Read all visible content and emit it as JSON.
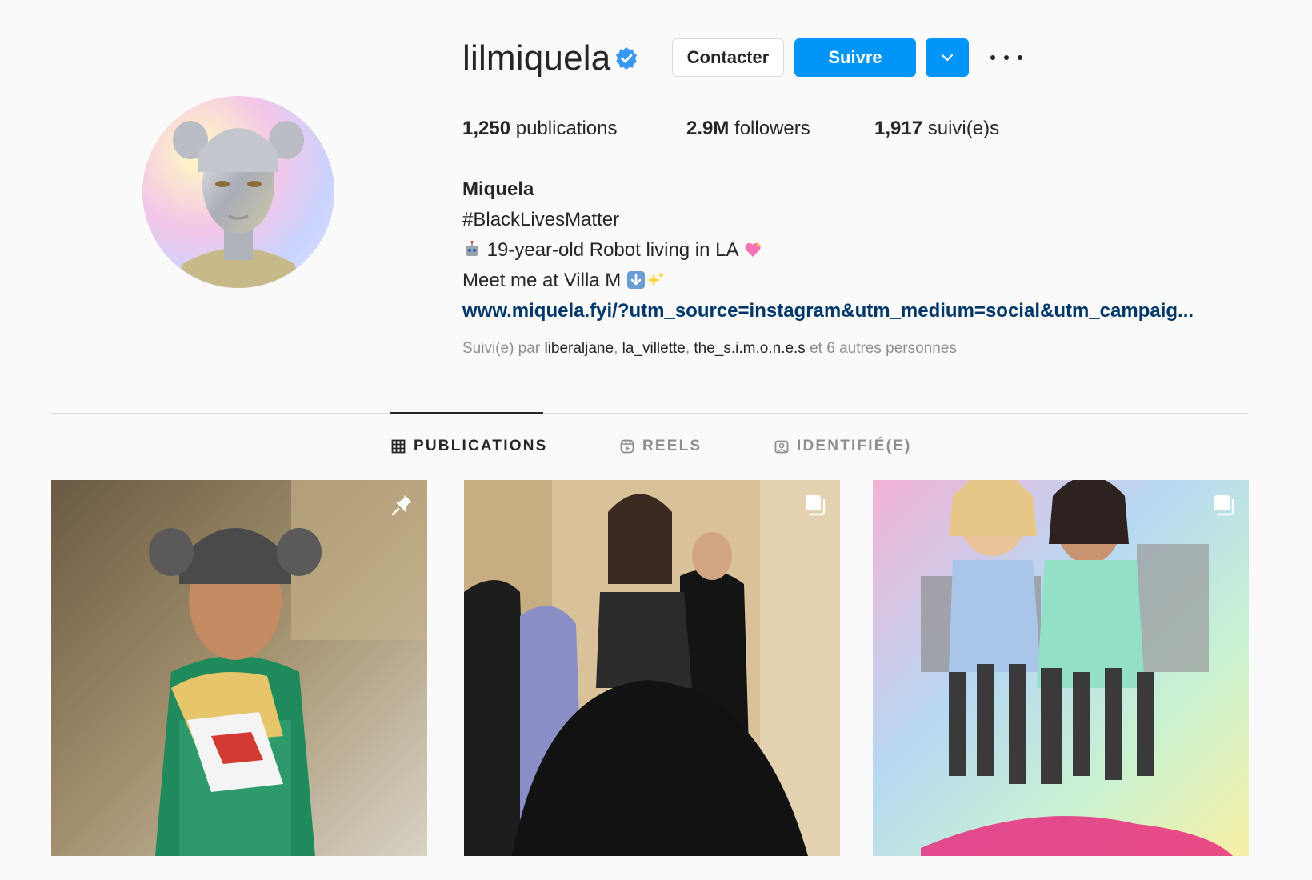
{
  "profile": {
    "username": "lilmiquela",
    "verified": true,
    "buttons": {
      "contact": "Contacter",
      "follow": "Suivre"
    },
    "stats": {
      "posts_count": "1,250",
      "posts_label": "publications",
      "followers_count": "2.9M",
      "followers_label": "followers",
      "following_count": "1,917",
      "following_label": "suivi(e)s"
    },
    "bio": {
      "name": "Miquela",
      "line1": "#BlackLivesMatter",
      "line2": "19-year-old Robot living in LA",
      "line3": "Meet me at Villa M",
      "link": "www.miquela.fyi/?utm_source=instagram&utm_medium=social&utm_campaig..."
    },
    "followed_by": {
      "prefix": "Suivi(e) par",
      "users": [
        "liberaljane",
        "la_villette",
        "the_s.i.m.o.n.e.s"
      ],
      "suffix": "et 6 autres personnes"
    }
  },
  "tabs": [
    {
      "label": "PUBLICATIONS",
      "icon": "grid-icon",
      "active": true
    },
    {
      "label": "REELS",
      "icon": "reels-icon",
      "active": false
    },
    {
      "label": "IDENTIFIÉ(E)",
      "icon": "tagged-icon",
      "active": false
    }
  ],
  "posts": [
    {
      "badge": "pin-icon"
    },
    {
      "badge": "carousel-icon"
    },
    {
      "badge": "carousel-icon"
    }
  ],
  "colors": {
    "accent": "#0095f6",
    "link": "#00376b",
    "muted": "#8e8e8e",
    "text": "#262626"
  }
}
